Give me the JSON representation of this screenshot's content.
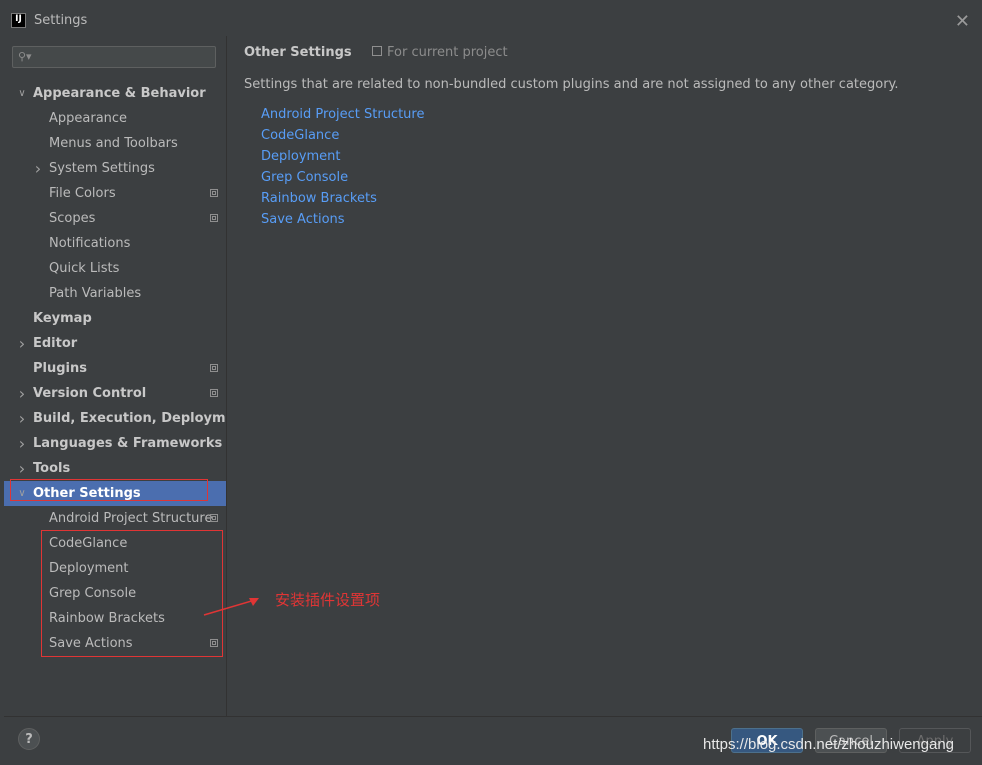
{
  "window": {
    "title": "Settings",
    "app_icon_text": "IJ",
    "close_label": "✕"
  },
  "search": {
    "placeholder": "",
    "icon": "search-icon"
  },
  "tree": [
    {
      "label": "Appearance & Behavior",
      "level": 0,
      "expanded": true,
      "bold": true
    },
    {
      "label": "Appearance",
      "level": 1
    },
    {
      "label": "Menus and Toolbars",
      "level": 1
    },
    {
      "label": "System Settings",
      "level": 1,
      "collapsed": true
    },
    {
      "label": "File Colors",
      "level": 1,
      "project": true
    },
    {
      "label": "Scopes",
      "level": 1,
      "project": true
    },
    {
      "label": "Notifications",
      "level": 1
    },
    {
      "label": "Quick Lists",
      "level": 1
    },
    {
      "label": "Path Variables",
      "level": 1
    },
    {
      "label": "Keymap",
      "level": 0,
      "bold": true
    },
    {
      "label": "Editor",
      "level": 0,
      "bold": true,
      "collapsed": true
    },
    {
      "label": "Plugins",
      "level": 0,
      "bold": true,
      "project": true
    },
    {
      "label": "Version Control",
      "level": 0,
      "bold": true,
      "collapsed": true,
      "project": true
    },
    {
      "label": "Build, Execution, Deployment",
      "level": 0,
      "bold": true,
      "collapsed": true
    },
    {
      "label": "Languages & Frameworks",
      "level": 0,
      "bold": true,
      "collapsed": true
    },
    {
      "label": "Tools",
      "level": 0,
      "bold": true,
      "collapsed": true
    },
    {
      "label": "Other Settings",
      "level": 0,
      "bold": true,
      "expanded": true,
      "selected": true
    },
    {
      "label": "Android Project Structure",
      "level": 1,
      "project": true
    },
    {
      "label": "CodeGlance",
      "level": 1
    },
    {
      "label": "Deployment",
      "level": 1
    },
    {
      "label": "Grep Console",
      "level": 1
    },
    {
      "label": "Rainbow Brackets",
      "level": 1
    },
    {
      "label": "Save Actions",
      "level": 1,
      "project": true
    }
  ],
  "content": {
    "title": "Other Settings",
    "scope_label": "For current project",
    "description": "Settings that are related to non-bundled custom plugins and are not assigned to any other category.",
    "links": [
      "Android Project Structure",
      "CodeGlance",
      "Deployment",
      "Grep Console",
      "Rainbow Brackets",
      "Save Actions"
    ]
  },
  "annotation": {
    "text": "安装插件设置项",
    "color": "#e03535"
  },
  "footer": {
    "help_label": "?",
    "ok_label": "OK",
    "cancel_label": "Cancel",
    "apply_label": "Apply"
  },
  "watermark": "https://blog.csdn.net/zhouzhiwengang",
  "colors": {
    "background": "#3c3f41",
    "selection": "#4b6eaf",
    "link": "#589df6",
    "ok_button": "#365880"
  }
}
